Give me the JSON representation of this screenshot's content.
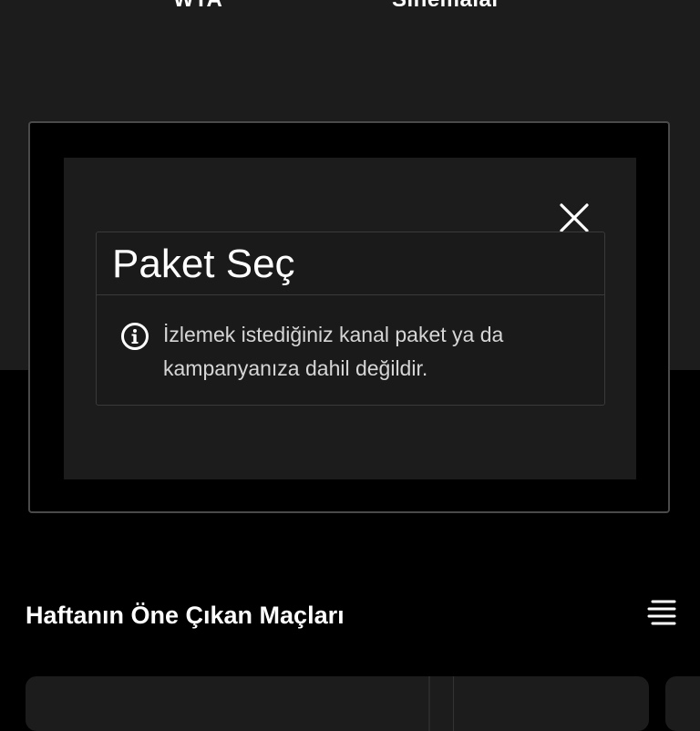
{
  "top_labels": [
    "WTA",
    "Sinemalar"
  ],
  "dialog": {
    "title": "Paket Seç",
    "message": "İzlemek istediğiniz kanal paket ya da kampanyanıza dahil değildir.",
    "info_icon": "info-circle-icon",
    "close_icon": "close-icon"
  },
  "section": {
    "title": "Haftanın Öne Çıkan Maçları",
    "menu_icon": "menu-icon"
  },
  "colors": {
    "background": "#000000",
    "panel": "#1c1c1c",
    "border": "#4a4a4a",
    "text": "#ffffff"
  }
}
